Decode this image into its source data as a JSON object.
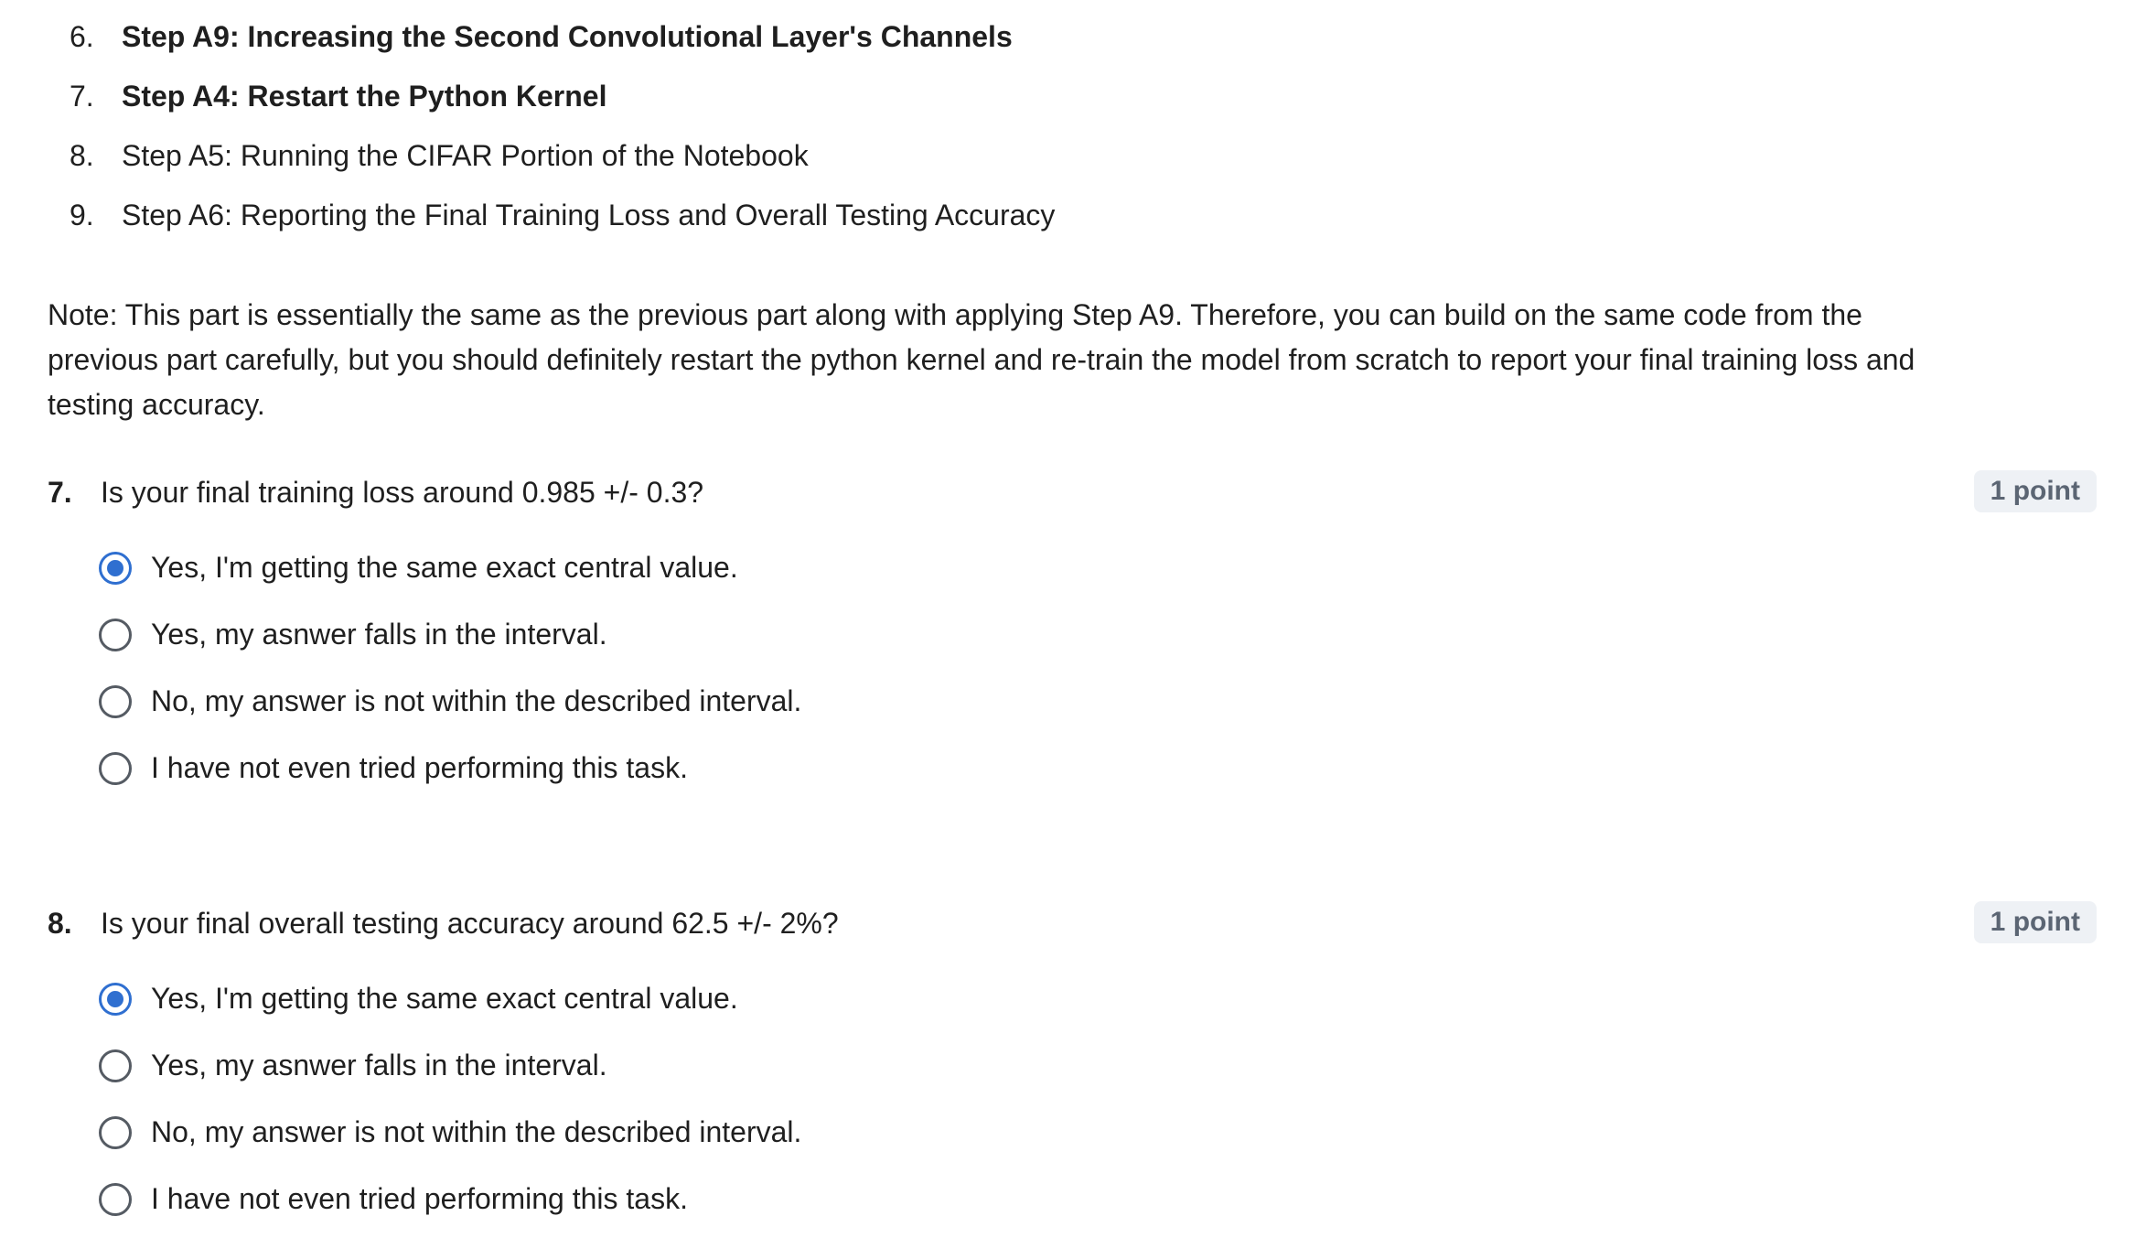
{
  "steps": [
    {
      "num": "6.",
      "text": "Step A9: Increasing the Second Convolutional Layer's Channels",
      "bold": true
    },
    {
      "num": "7.",
      "text": "Step A4: Restart the Python Kernel",
      "bold": true
    },
    {
      "num": "8.",
      "text": "Step A5: Running the CIFAR Portion of the Notebook",
      "bold": false
    },
    {
      "num": "9.",
      "text": "Step A6: Reporting the Final Training Loss and Overall Testing Accuracy",
      "bold": false
    }
  ],
  "note": "Note: This part is essentially the same as the previous part along with applying Step A9. Therefore, you can build on the same code from the previous part carefully, but you should definitely restart the python kernel and re-train the model from scratch to report your final training loss and testing accuracy.",
  "questions": [
    {
      "num": "7.",
      "text": "Is your final training loss around 0.985 +/- 0.3?",
      "points": "1 point",
      "selected_index": 0,
      "options": [
        "Yes, I'm getting the same exact central value.",
        "Yes, my asnwer falls in the interval.",
        "No, my answer is not within the described interval.",
        "I have not even tried performing this task."
      ]
    },
    {
      "num": "8.",
      "text": "Is your final overall testing accuracy around 62.5 +/- 2%?",
      "points": "1 point",
      "selected_index": 0,
      "options": [
        "Yes, I'm getting the same exact central value.",
        "Yes, my asnwer falls in the interval.",
        "No, my answer is not within the described interval.",
        "I have not even tried performing this task."
      ]
    }
  ],
  "colors": {
    "radio_selected": "#2f6fd0",
    "radio_unselected": "#555b63",
    "badge_bg": "#eef1f5",
    "badge_text": "#5b6573"
  }
}
